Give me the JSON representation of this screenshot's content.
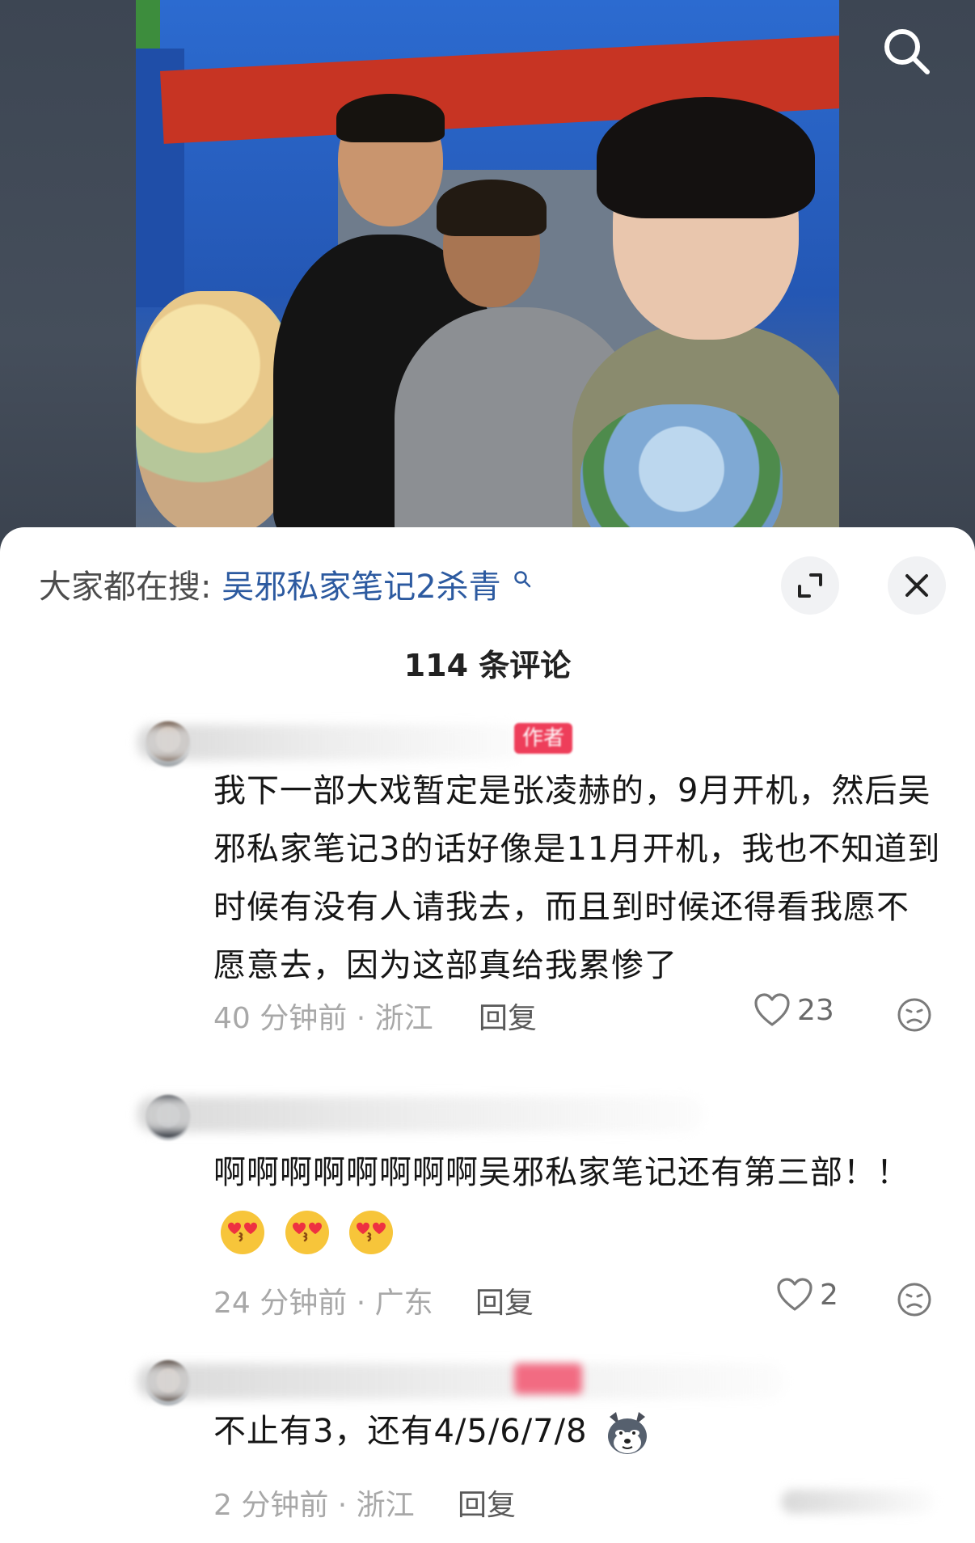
{
  "top_bar": {
    "search_icon": "search-icon"
  },
  "trending": {
    "label": "大家都在搜:",
    "query": "吴邪私家笔记2杀青",
    "query_icon": "search-small-icon"
  },
  "sheet_controls": {
    "expand_icon": "expand-icon",
    "close_icon": "close-icon"
  },
  "comments_header": {
    "count_label": "114 条评论"
  },
  "comments": [
    {
      "author_badge": "作者",
      "text": "我下一部大戏暂定是张凌赫的，9月开机，然后吴邪私家笔记3的话好像是11月开机，我也不知道到时候有没有人请我去，而且到时候还得看我愿不愿意去，因为这部真给我累惨了",
      "meta": "40 分钟前 · 浙江",
      "reply_label": "回复",
      "likes": "23"
    },
    {
      "text": "啊啊啊啊啊啊啊啊吴邪私家笔记还有第三部！！",
      "emojis": [
        "heart-eyes-kiss-emoji",
        "heart-eyes-kiss-emoji",
        "heart-eyes-kiss-emoji"
      ],
      "meta": "24 分钟前 · 广东",
      "reply_label": "回复",
      "likes": "2"
    },
    {
      "text": "不止有3，还有4/5/6/7/8",
      "emojis": [
        "husky-dog-emoji"
      ],
      "meta": "2 分钟前 · 浙江",
      "reply_label": "回复"
    }
  ],
  "colors": {
    "link_blue": "#2c5aa0",
    "author_badge": "#ee3e5a",
    "meta_gray": "#a8a8a8",
    "banner_red": "#c73423"
  }
}
